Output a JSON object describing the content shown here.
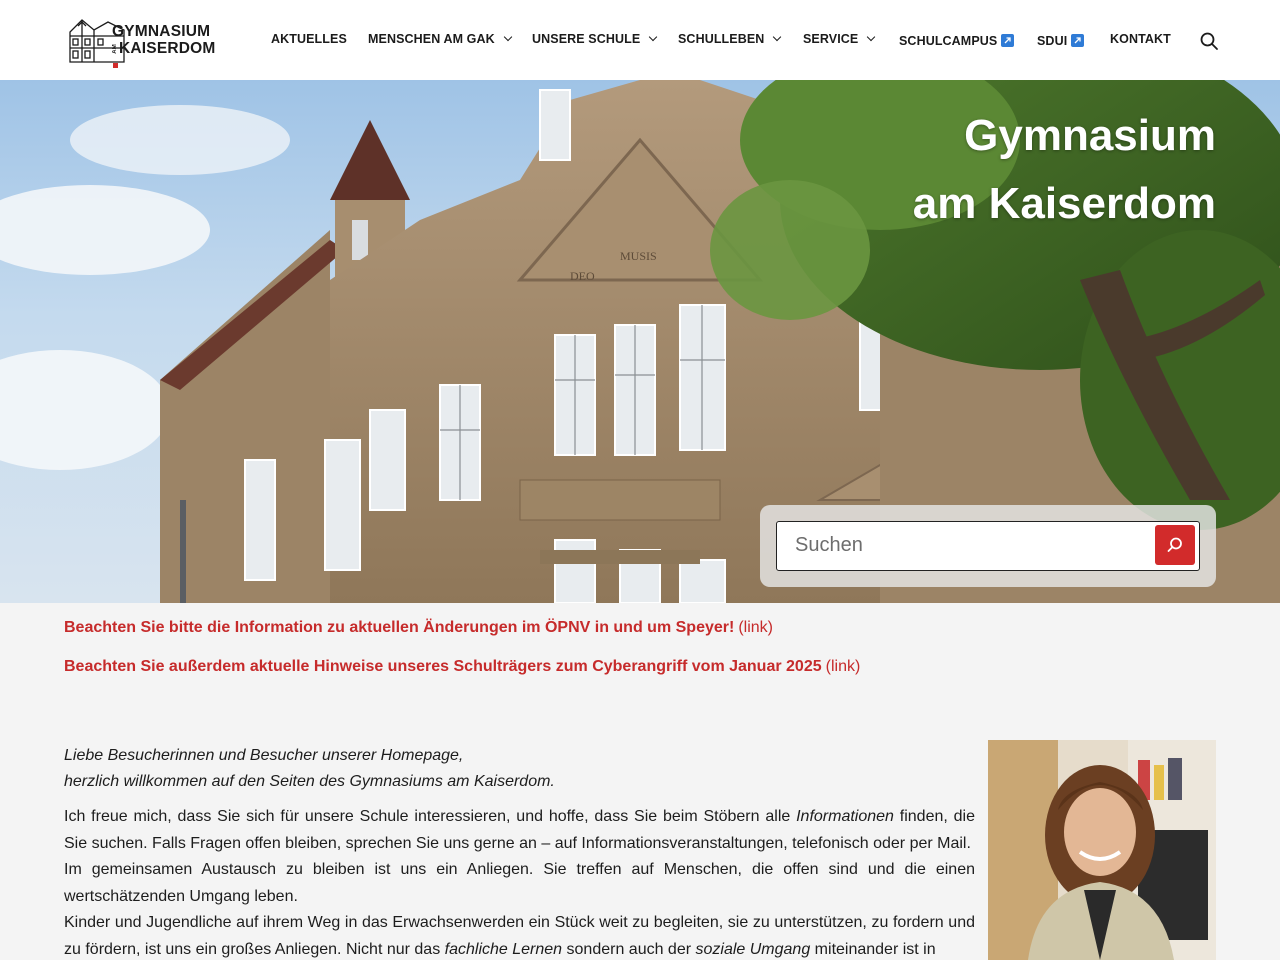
{
  "header": {
    "logo": {
      "line1": "GYMNASIUM",
      "am": "AM",
      "line2": "KAISERDOM"
    },
    "nav": [
      {
        "label": "AKTUELLES",
        "dropdown": false,
        "external": false
      },
      {
        "label": "MENSCHEN AM GAK",
        "dropdown": true,
        "external": false
      },
      {
        "label": "UNSERE SCHULE",
        "dropdown": true,
        "external": false
      },
      {
        "label": "SCHULLEBEN",
        "dropdown": true,
        "external": false
      },
      {
        "label": "SERVICE",
        "dropdown": true,
        "external": false
      },
      {
        "label": "SCHULCAMPUS",
        "dropdown": false,
        "external": true
      },
      {
        "label": "SDUI",
        "dropdown": false,
        "external": true
      },
      {
        "label": "KONTAKT",
        "dropdown": false,
        "external": false
      }
    ],
    "search_icon": "search-icon"
  },
  "hero": {
    "title_line1": "Gymnasium",
    "title_line2": "am Kaiserdom",
    "search": {
      "placeholder": "Suchen",
      "submit_icon": "search-icon"
    }
  },
  "notices": [
    {
      "text": "Beachten Sie bitte die Information zu aktuellen Änderungen im ÖPNV in und um Speyer!",
      "link": "(link)"
    },
    {
      "text": "Beachten Sie außerdem aktuelle Hinweise unseres Schulträgers zum Cyberangriff vom Januar 2025",
      "link": "(link)"
    }
  ],
  "content": {
    "greeting_line1": "Liebe Besucherinnen und Besucher unserer Homepage,",
    "greeting_line2": "herzlich willkommen auf den Seiten des Gymnasiums am Kaiserdom.",
    "p1_a": "Ich freue mich, dass Sie sich für unsere Schule interessieren, und hoffe, dass Sie beim Stöbern alle ",
    "p1_em": "Informationen",
    "p1_b": " finden, die Sie suchen. Falls Fragen offen bleiben, sprechen Sie uns gerne an – auf Informationsveranstaltungen, telefonisch oder per Mail.",
    "p2": "Im gemeinsamen Austausch zu bleiben ist uns ein Anliegen. Sie treffen auf Menschen, die offen sind und die einen wertschätzenden Umgang leben.",
    "p3_a": "Kinder und Jugendliche auf ihrem Weg in das Erwachsenwerden ein Stück weit zu begleiten, sie zu unterstützen, zu fordern und zu fördern, ist uns ein großes Anliegen. Nicht nur das ",
    "p3_em1": "fachliche Lernen",
    "p3_b": " sondern auch der ",
    "p3_em2": "soziale Umgang",
    "p3_c": " miteinander ist in"
  },
  "colors": {
    "accent": "#d22b2b",
    "notice": "#c62b2b",
    "background": "#f4f4f4"
  }
}
